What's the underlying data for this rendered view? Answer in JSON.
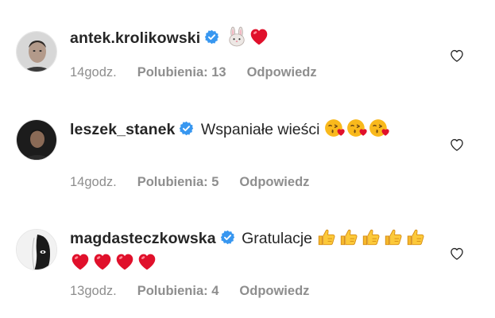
{
  "comments": [
    {
      "username": "antek.krolikowski",
      "verified": true,
      "text": "",
      "emojis": [
        "rabbit-face",
        "red-heart"
      ],
      "time": "14godz.",
      "likes": "Polubienia: 13",
      "reply": "Odpowiedz"
    },
    {
      "username": "leszek_stanek",
      "verified": true,
      "text": "Wspaniałe wieści",
      "emojis": [
        "face-blowing-kiss",
        "face-blowing-kiss",
        "face-blowing-kiss"
      ],
      "time": "14godz.",
      "likes": "Polubienia: 5",
      "reply": "Odpowiedz"
    },
    {
      "username": "magdasteczkowska",
      "verified": true,
      "text": "Gratulacje",
      "emojis": [
        "thumbs-up",
        "thumbs-up",
        "thumbs-up",
        "thumbs-up",
        "thumbs-up",
        "red-heart",
        "red-heart",
        "red-heart",
        "red-heart"
      ],
      "time": "13godz.",
      "likes": "Polubienia: 4",
      "reply": "Odpowiedz"
    }
  ],
  "colors": {
    "verified_badge": "#3897f0",
    "meta_text": "#8e8e8e",
    "heart_emoji": "#e0102b",
    "thumbs_emoji": "#f5b82e",
    "kiss_face": "#f9b91c"
  }
}
